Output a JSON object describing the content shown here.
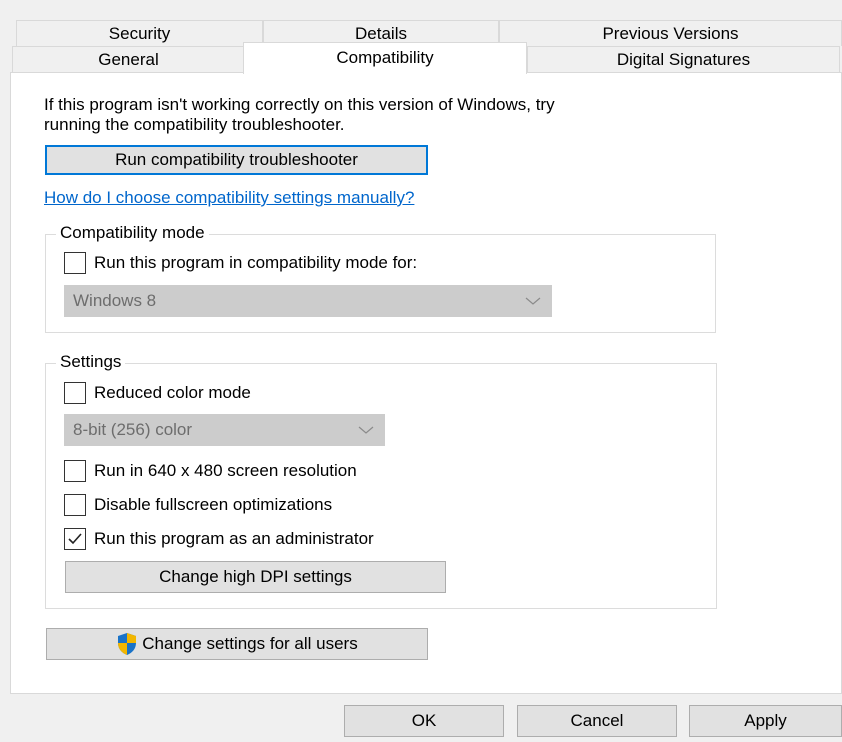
{
  "tabs": {
    "row_back": [
      "Security",
      "Details",
      "Previous Versions"
    ],
    "row_front": [
      "General",
      "Compatibility",
      "Digital Signatures"
    ],
    "active": "Compatibility"
  },
  "intro": {
    "line1": "If this program isn't working correctly on this version of Windows, try",
    "line2": "running the compatibility troubleshooter."
  },
  "troubleshooter_button": "Run compatibility troubleshooter",
  "manual_link": "How do I choose compatibility settings manually?",
  "compat_mode": {
    "legend": "Compatibility mode",
    "checkbox_label": "Run this program in compatibility mode for:",
    "checked": false,
    "dropdown_value": "Windows 8"
  },
  "settings": {
    "legend": "Settings",
    "reduced_color_label": "Reduced color mode",
    "reduced_color_checked": false,
    "color_dropdown_value": "8-bit (256) color",
    "res_label": "Run in 640 x 480 screen resolution",
    "res_checked": false,
    "fullscreen_label": "Disable fullscreen optimizations",
    "fullscreen_checked": false,
    "admin_label": "Run this program as an administrator",
    "admin_checked": true,
    "dpi_button": "Change high DPI settings"
  },
  "all_users_button": "Change settings for all users",
  "footer": {
    "ok": "OK",
    "cancel": "Cancel",
    "apply": "Apply"
  },
  "colors": {
    "link": "#0066cc",
    "focus_border": "#0078d7",
    "shield_blue": "#1a73c8",
    "shield_yellow": "#f2b600"
  }
}
